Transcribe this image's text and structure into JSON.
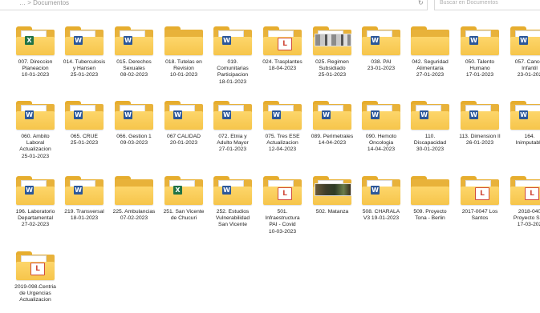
{
  "toolbar": {
    "address_text": "…  > Documentos",
    "search_placeholder": "Buscar en Documentos",
    "refresh_icon": "refresh-icon"
  },
  "folders": [
    {
      "name": "007. Direccion\nPlaneacion\n10-01-2023",
      "icon": "excel-file-icon",
      "overlay": "x"
    },
    {
      "name": "014. Tuberculosis\ny Hansen\n25-01-2023",
      "icon": "word-file-icon",
      "overlay": "w"
    },
    {
      "name": "015. Derechos\nSexuales\n08-02-2023",
      "icon": "word-file-icon",
      "overlay": "w"
    },
    {
      "name": "018. Tutelas en\nRevision\n10-01-2023",
      "icon": "folder-icon",
      "overlay": ""
    },
    {
      "name": "019.\nComunitarias\nParticipacion\n18-01-2023",
      "icon": "word-file-icon",
      "overlay": "w"
    },
    {
      "name": "024. Trasplantes\n18-04-2023",
      "icon": "pdf-file-icon",
      "overlay": "p"
    },
    {
      "name": "025. Regimen\nSubsidiado\n25-01-2023",
      "icon": "document-thumbnail-icon",
      "overlay": "doc"
    },
    {
      "name": "038. PAI\n23-01-2023",
      "icon": "word-file-icon",
      "overlay": "w"
    },
    {
      "name": "042. Seguridad\nAlimentaria\n27-01-2023",
      "icon": "folder-icon",
      "overlay": ""
    },
    {
      "name": "050. Talento\nHumano\n17-01-2023",
      "icon": "word-file-icon",
      "overlay": "w"
    },
    {
      "name": "057. Cancer\nInfantil\n23-01-202",
      "icon": "word-file-icon",
      "overlay": "w"
    },
    {
      "name": "060. Ambito\nLaboral\nActualizacion\n25-01-2023",
      "icon": "word-file-icon",
      "overlay": "w"
    },
    {
      "name": "065. CRUE\n25-01-2023",
      "icon": "word-file-icon",
      "overlay": "w"
    },
    {
      "name": "066. Gestion 1\n09-03-2023",
      "icon": "word-file-icon",
      "overlay": "w"
    },
    {
      "name": "067 CALIDAD\n20-01-2023",
      "icon": "word-file-icon",
      "overlay": "w"
    },
    {
      "name": "072. Etnia y\nAdulto Mayor\n27-01-2023",
      "icon": "word-file-icon",
      "overlay": "w"
    },
    {
      "name": "075. Tres ESE\nActualizacion\n12-04-2023",
      "icon": "word-file-icon",
      "overlay": "w"
    },
    {
      "name": "089. Perimetrales\n14-04-2023",
      "icon": "word-file-icon",
      "overlay": "w"
    },
    {
      "name": "090. Hemoto\nOncologia\n14-04-2023",
      "icon": "word-file-icon",
      "overlay": "w"
    },
    {
      "name": "110.\nDiscapacidad\n30-01-2023",
      "icon": "word-file-icon",
      "overlay": "w"
    },
    {
      "name": "113. Dimension II\n26-01-2023",
      "icon": "word-file-icon",
      "overlay": "w"
    },
    {
      "name": "164.\nInimputable",
      "icon": "word-file-icon",
      "overlay": "w"
    },
    {
      "name": "196. Laboratorio\nDepartamental\n27-02-2023",
      "icon": "word-file-icon",
      "overlay": "w"
    },
    {
      "name": "219. Transversal\n18-01-2023",
      "icon": "word-file-icon",
      "overlay": "w"
    },
    {
      "name": "225. Ambulancias\n07-02-2023",
      "icon": "folder-icon",
      "overlay": ""
    },
    {
      "name": "251. San Vicente\nde Chucuri",
      "icon": "excel-file-icon",
      "overlay": "x"
    },
    {
      "name": "252. Estudios\nVulnerabilidad\nSan Vicente",
      "icon": "word-file-icon",
      "overlay": "w"
    },
    {
      "name": "501.\nInfraestructura\nPAI - Covid\n10-03-2023",
      "icon": "pdf-file-icon",
      "overlay": "p"
    },
    {
      "name": "502. Matanza",
      "icon": "photo-thumbnail-icon",
      "overlay": "dark"
    },
    {
      "name": "508. CHARALA\nV3 19-01-2023",
      "icon": "word-file-icon",
      "overlay": "w"
    },
    {
      "name": "509. Proyecto\nTona - Berlin",
      "icon": "folder-icon",
      "overlay": ""
    },
    {
      "name": "2017-0047 Los\nSantos",
      "icon": "pdf-file-icon",
      "overlay": "p"
    },
    {
      "name": "2018-040\nProyecto San\n17-03-202",
      "icon": "pdf-file-icon",
      "overlay": "p"
    },
    {
      "name": "2019-098.Centria\nde Urgencias\nActualizacion",
      "icon": "pdf-file-icon",
      "overlay": "p"
    }
  ]
}
